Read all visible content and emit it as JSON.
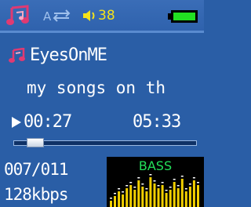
{
  "status": {
    "volume": "38",
    "battery_level": 1.0
  },
  "track": {
    "title": "EyesOnME",
    "album_scroll": "my songs on th",
    "state": "playing",
    "elapsed": "00:27",
    "total": "05:33",
    "progress": 0.081
  },
  "playlist": {
    "counter": "007/011"
  },
  "audio": {
    "bitrate": "128kbps",
    "eq_preset": "BASS",
    "eq_levels": [
      0.2,
      0.35,
      0.5,
      0.4,
      0.6,
      0.7,
      0.55,
      0.85,
      0.65,
      0.5,
      0.95,
      0.75,
      0.6,
      0.7,
      0.45,
      0.55,
      0.8,
      0.6,
      0.9,
      0.5,
      0.65,
      0.85,
      0.7
    ]
  },
  "icons": [
    "music-note-icon",
    "repeat-icon",
    "volume-icon",
    "battery-icon",
    "play-icon"
  ],
  "colors": {
    "background": "#2a5ea6",
    "text": "#ffffff",
    "volume_text": "#f5e21a",
    "battery_fill": "#22e022",
    "eq_label": "#22e05a",
    "eq_bar": "#f2d000"
  }
}
